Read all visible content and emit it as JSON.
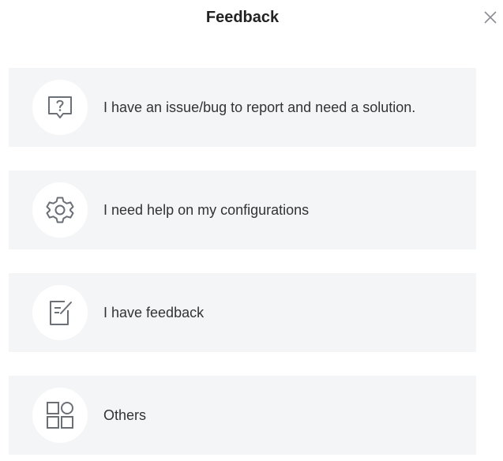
{
  "dialog": {
    "title": "Feedback",
    "close_icon": "close-icon"
  },
  "options": [
    {
      "label": "I have an issue/bug to report and need a solution.",
      "icon": "question-chat-icon"
    },
    {
      "label": "I need help on my configurations",
      "icon": "gear-icon"
    },
    {
      "label": "I have feedback",
      "icon": "edit-note-icon"
    },
    {
      "label": "Others",
      "icon": "grid-shapes-icon"
    }
  ],
  "colors": {
    "card_background": "#f4f5f7",
    "icon_stroke": "#6b6f76",
    "title_text": "#222222"
  }
}
